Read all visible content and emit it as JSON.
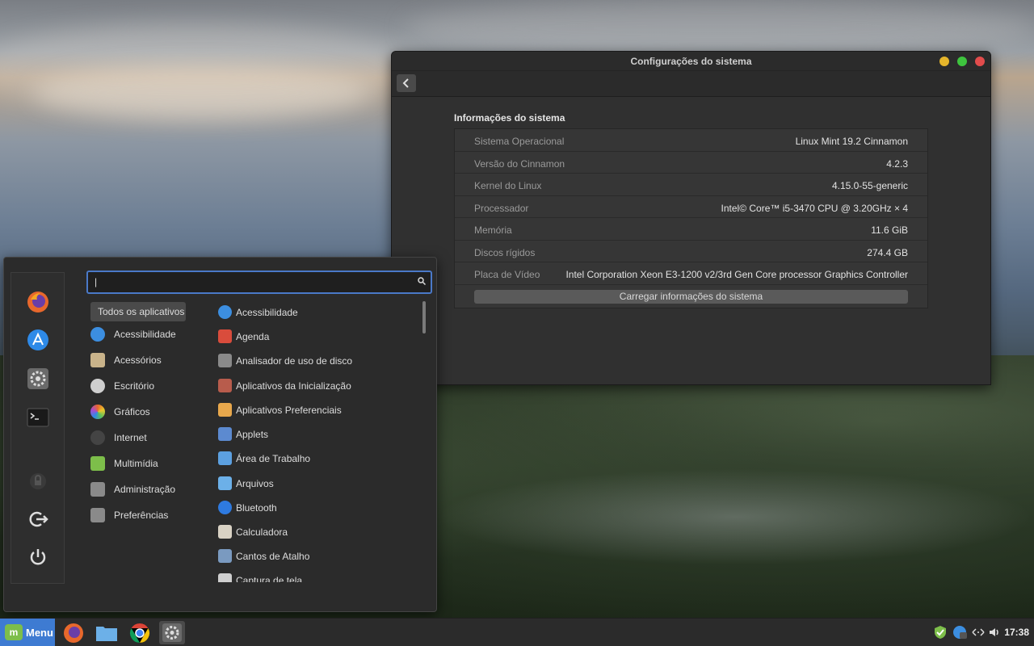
{
  "settings_window": {
    "title": "Configurações do sistema",
    "section_title": "Informações do sistema",
    "rows": [
      {
        "label": "Sistema Operacional",
        "value": "Linux Mint 19.2 Cinnamon"
      },
      {
        "label": "Versão do Cinnamon",
        "value": "4.2.3"
      },
      {
        "label": "Kernel do Linux",
        "value": "4.15.0-55-generic"
      },
      {
        "label": "Processador",
        "value": "Intel© Core™ i5-3470 CPU @ 3.20GHz × 4"
      },
      {
        "label": "Memória",
        "value": "11.6 GiB"
      },
      {
        "label": "Discos rígidos",
        "value": "274.4 GB"
      },
      {
        "label": "Placa de Vídeo",
        "value": "Intel Corporation Xeon E3-1200 v2/3rd Gen Core processor Graphics Controller"
      }
    ],
    "load_button": "Carregar informações do sistema"
  },
  "menu": {
    "search_value": "|",
    "categories": [
      {
        "label": "Todos os aplicativos",
        "icon": "all-apps-icon",
        "color": "#4a4a4a"
      },
      {
        "label": "Acessibilidade",
        "icon": "accessibility-icon",
        "color": "#3c8ee0"
      },
      {
        "label": "Acessórios",
        "icon": "accessories-icon",
        "color": "#c9b38a"
      },
      {
        "label": "Escritório",
        "icon": "office-icon",
        "color": "#cfcfcf"
      },
      {
        "label": "Gráficos",
        "icon": "graphics-icon",
        "color": "#e08a3c"
      },
      {
        "label": "Internet",
        "icon": "internet-icon",
        "color": "#555555"
      },
      {
        "label": "Multimídia",
        "icon": "multimedia-icon",
        "color": "#7dbe4a"
      },
      {
        "label": "Administração",
        "icon": "administration-icon",
        "color": "#8a8a8a"
      },
      {
        "label": "Preferências",
        "icon": "preferences-icon",
        "color": "#8a8a8a"
      }
    ],
    "apps": [
      {
        "label": "Acessibilidade",
        "icon": "accessibility-icon",
        "color": "#3c8ee0"
      },
      {
        "label": "Agenda",
        "icon": "calendar-icon",
        "color": "#d94c3c"
      },
      {
        "label": "Analisador de uso de disco",
        "icon": "disk-usage-icon",
        "color": "#8a8a8a"
      },
      {
        "label": "Aplicativos da Inicialização",
        "icon": "startup-apps-icon",
        "color": "#b85c4c"
      },
      {
        "label": "Aplicativos Preferenciais",
        "icon": "preferred-apps-icon",
        "color": "#e8a84c"
      },
      {
        "label": "Applets",
        "icon": "applets-icon",
        "color": "#5c8ad0"
      },
      {
        "label": "Área de Trabalho",
        "icon": "desktop-icon",
        "color": "#5ca0e0"
      },
      {
        "label": "Arquivos",
        "icon": "folder-icon",
        "color": "#6cb0e8"
      },
      {
        "label": "Bluetooth",
        "icon": "bluetooth-icon",
        "color": "#2e7ae0"
      },
      {
        "label": "Calculadora",
        "icon": "calculator-icon",
        "color": "#d9d2c4"
      },
      {
        "label": "Cantos de Atalho",
        "icon": "hot-corners-icon",
        "color": "#7a9ac0"
      },
      {
        "label": "Captura de tela",
        "icon": "screenshot-icon",
        "color": "#cfcfcf"
      }
    ],
    "favorites": [
      {
        "name": "firefox-icon",
        "color": "#e8682c"
      },
      {
        "name": "software-manager-icon",
        "color": "#2e8ae8"
      },
      {
        "name": "system-settings-icon",
        "color": "#6a6a6a"
      },
      {
        "name": "terminal-icon",
        "color": "#1a1a1a"
      }
    ],
    "session": [
      "lock-icon",
      "logout-icon",
      "power-icon"
    ]
  },
  "taskbar": {
    "menu_label": "Menu",
    "clock": "17:38"
  }
}
